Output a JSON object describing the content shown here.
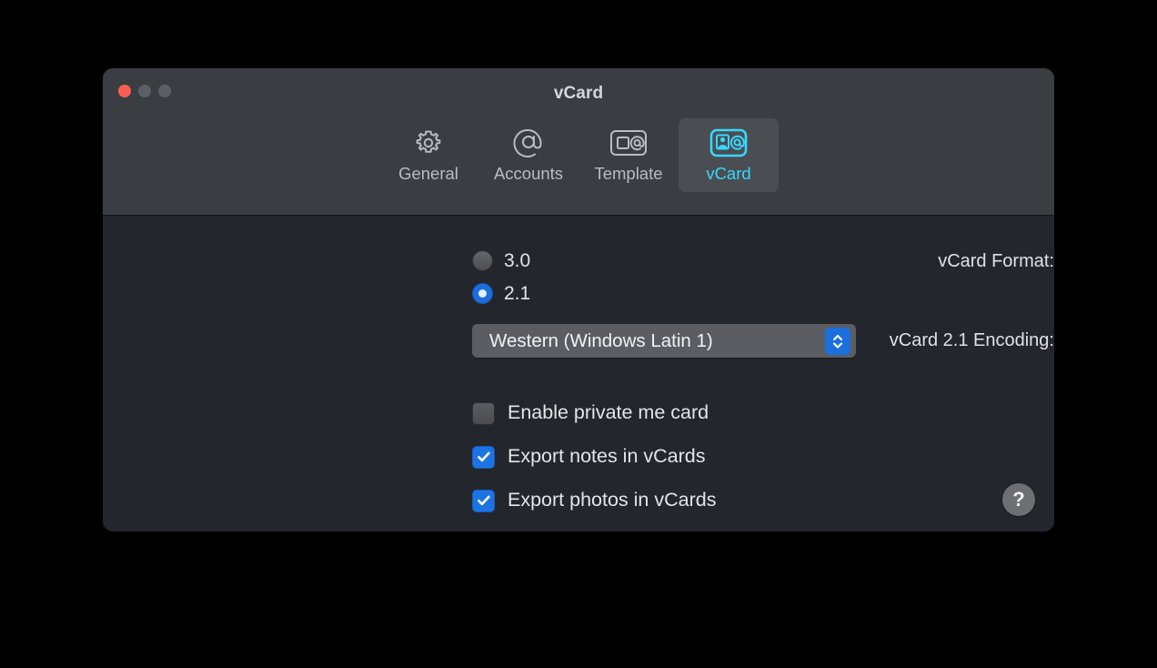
{
  "window": {
    "title": "vCard",
    "traffic_lights": [
      {
        "name": "close",
        "color": "#ff5f52"
      },
      {
        "name": "minimize",
        "color": "#5c5f65"
      },
      {
        "name": "zoom",
        "color": "#5c5f65"
      }
    ]
  },
  "toolbar": {
    "tabs": [
      {
        "label": "General",
        "icon": "gear-icon",
        "selected": false
      },
      {
        "label": "Accounts",
        "icon": "at-sign-icon",
        "selected": false
      },
      {
        "label": "Template",
        "icon": "template-icon",
        "selected": false
      },
      {
        "label": "vCard",
        "icon": "vcard-icon",
        "selected": true
      }
    ]
  },
  "main": {
    "format_field": {
      "label": "vCard Format:",
      "options": [
        {
          "label": "3.0",
          "selected": false
        },
        {
          "label": "2.1",
          "selected": true
        }
      ]
    },
    "encoding_field": {
      "label": "vCard 2.1 Encoding:",
      "value": "Western (Windows Latin 1)"
    },
    "checkboxes": [
      {
        "label": "Enable private me card",
        "checked": false
      },
      {
        "label": "Export notes in vCards",
        "checked": true
      },
      {
        "label": "Export photos in vCards",
        "checked": true
      }
    ],
    "help_button": {
      "label": "?"
    }
  },
  "colors": {
    "accent_blue": "#1b6fdd",
    "selected_tab_cyan": "#35d9ff",
    "toolbar_bg": "#3a3d42",
    "content_bg": "#23262d",
    "close_red": "#ff5f52"
  }
}
